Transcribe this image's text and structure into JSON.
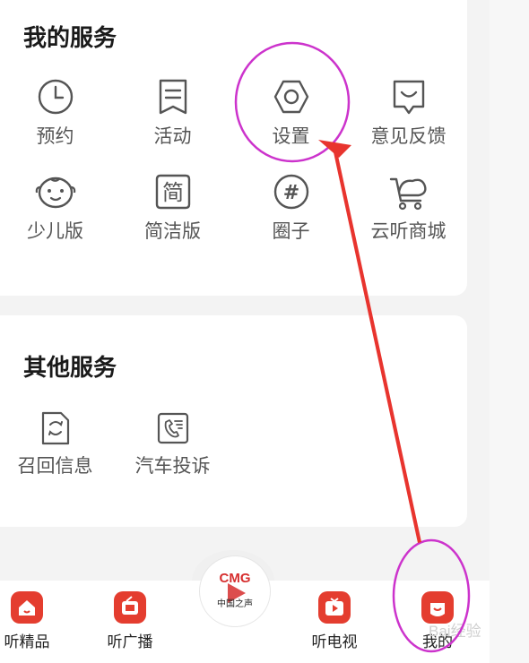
{
  "my_services": {
    "title": "我的服务",
    "items": [
      {
        "label": "预约",
        "icon": "clock-icon"
      },
      {
        "label": "活动",
        "icon": "bookmark-list-icon"
      },
      {
        "label": "设置",
        "icon": "hexagon-settings-icon"
      },
      {
        "label": "意见反馈",
        "icon": "feedback-icon"
      },
      {
        "label": "少儿版",
        "icon": "baby-face-icon"
      },
      {
        "label": "简洁版",
        "icon": "simple-mode-icon",
        "glyph": "简"
      },
      {
        "label": "圈子",
        "icon": "hashtag-icon",
        "glyph": "#"
      },
      {
        "label": "云听商城",
        "icon": "shopping-cart-icon"
      }
    ]
  },
  "other_services": {
    "title": "其他服务",
    "items": [
      {
        "label": "召回信息",
        "icon": "recall-document-icon"
      },
      {
        "label": "汽车投诉",
        "icon": "phone-complaint-icon"
      }
    ]
  },
  "bottom_nav": {
    "tabs": [
      {
        "label": "听精品",
        "icon": "home-icon"
      },
      {
        "label": "听广播",
        "icon": "radio-icon"
      },
      {
        "label": "听电视",
        "icon": "tv-play-icon"
      },
      {
        "label": "我的",
        "icon": "profile-icon",
        "active": true
      }
    ],
    "center": {
      "logo": "CMG",
      "sub": "中国之声",
      "icon": "play-icon"
    }
  },
  "watermark": "Bai经验",
  "colors": {
    "accent": "#e43d2f",
    "annotation": "#cc33cc",
    "arrow": "#e8342e"
  }
}
